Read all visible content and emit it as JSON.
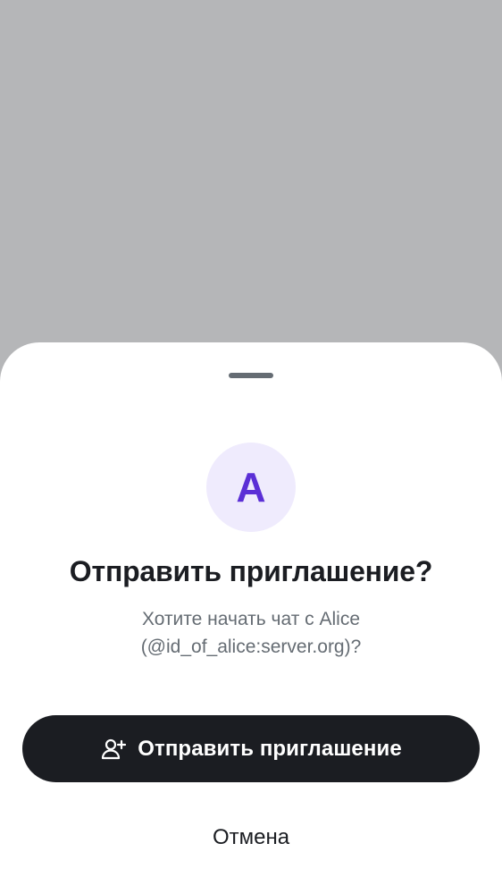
{
  "dialog": {
    "avatar_letter": "A",
    "title": "Отправить приглашение?",
    "subtitle_line1": "Хотите начать чат с Alice",
    "subtitle_line2": "(@id_of_alice:server.org)?",
    "primary_button": {
      "label": "Отправить приглашение",
      "icon": "person-add-icon"
    },
    "cancel_label": "Отмена"
  },
  "colors": {
    "scrim": "#b5b6b8",
    "sheet": "#ffffff",
    "handle": "#656c73",
    "avatar_bg": "#efebfd",
    "avatar_letter": "#5b2fd6",
    "primary": "#1b1d22",
    "secondary_text": "#656c73"
  }
}
